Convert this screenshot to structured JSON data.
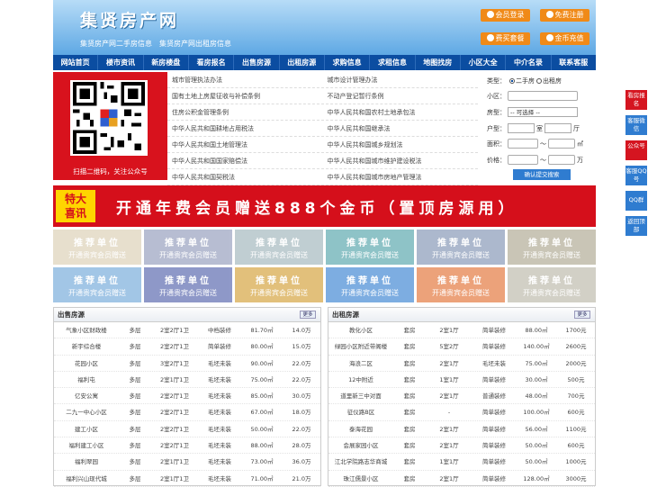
{
  "site": {
    "logo": "集贤房产网",
    "slogan1": "集贤房产网二手房信息",
    "slogan2": "集贤房产网出租房信息"
  },
  "header_buttons": [
    {
      "label": "会员登录"
    },
    {
      "label": "免费注册"
    },
    {
      "label": "费买套餐"
    },
    {
      "label": "金币充值"
    }
  ],
  "nav": [
    "网站首页",
    "楼市资讯",
    "新房楼盘",
    "看房报名",
    "出售房源",
    "出租房源",
    "求购信息",
    "求租信息",
    "地图找房",
    "小区大全",
    "中介名录",
    "联系客服"
  ],
  "qr_caption": "扫描二维码，关注公众号",
  "law_links": [
    [
      "城市管理执法办法",
      "城市设计管理办法"
    ],
    [
      "国有土地上房屋征收与补偿条例",
      "不动产登记暂行条例"
    ],
    [
      "住房公积金管理条例",
      "中华人民共和国农村土地承包法"
    ],
    [
      "中华人民共和国耕地占用税法",
      "中华人民共和国继承法"
    ],
    [
      "中华人民共和国土地管理法",
      "中华人民共和国城乡规划法"
    ],
    [
      "中华人民共和国国家赔偿法",
      "中华人民共和国城市维护建设税法"
    ],
    [
      "中华人民共和国契税法",
      "中华人民共和国城市房地产管理法"
    ]
  ],
  "search": {
    "type_label": "类型：",
    "opt_sale": "二手房",
    "opt_rent": "出租房",
    "area_label": "小区：",
    "house_label": "房型：",
    "house_value": "-- 可选择 --",
    "layout_label": "户型：",
    "room": "室",
    "hall": "厅",
    "size_label": "面积：",
    "size_unit": "㎡",
    "price_label": "价格：",
    "price_unit": "万",
    "dash": "～",
    "submit": "确认提交搜索"
  },
  "banner": {
    "badge1": "特大",
    "badge2": "喜讯",
    "text": "开通年费会员赠送888个金币（置顶房源用）"
  },
  "ads": {
    "title": "推荐单位",
    "sub": "开通贵宾会员赠送"
  },
  "ad_colors": [
    "#d9ccb0",
    "#8c96b8",
    "#9bb1b8",
    "#4aa0a6",
    "#7a8db0",
    "#a9a38a",
    "#6aa4d8",
    "#4a5aa8",
    "#d19a2c",
    "#2f7cd0",
    "#e26a2a",
    "#b8b4a4"
  ],
  "sale": {
    "title": "出售房源",
    "more": "更多",
    "rows": [
      [
        "气象小区财政楼",
        "多层",
        "2室2厅1卫",
        "中档装修",
        "81.70㎡",
        "14.0万"
      ],
      [
        "新宇综合楼",
        "多层",
        "2室2厅1卫",
        "简单装修",
        "80.00㎡",
        "15.0万"
      ],
      [
        "花园小区",
        "多层",
        "3室2厅1卫",
        "毛坯未装",
        "90.00㎡",
        "22.0万"
      ],
      [
        "福利屯",
        "多层",
        "2室1厅1卫",
        "毛坯未装",
        "75.00㎡",
        "22.0万"
      ],
      [
        "亿安公寓",
        "多层",
        "2室2厅1卫",
        "毛坯未装",
        "85.00㎡",
        "30.0万"
      ],
      [
        "二九一中心小区",
        "多层",
        "2室2厅1卫",
        "毛坯未装",
        "67.00㎡",
        "18.0万"
      ],
      [
        "建工小区",
        "多层",
        "2室2厅1卫",
        "毛坯未装",
        "50.00㎡",
        "22.0万"
      ],
      [
        "福利建工小区",
        "多层",
        "2室2厅1卫",
        "毛坯未装",
        "88.00㎡",
        "28.0万"
      ],
      [
        "福利翠园",
        "多层",
        "2室1厅1卫",
        "毛坯未装",
        "73.00㎡",
        "36.0万"
      ],
      [
        "福利兴山现代城",
        "多层",
        "2室1厅1卫",
        "毛坯未装",
        "71.00㎡",
        "21.0万"
      ]
    ]
  },
  "rent": {
    "title": "出租房源",
    "more": "更多",
    "rows": [
      [
        "教化小区",
        "套房",
        "2室1厅",
        "简单装修",
        "88.00㎡",
        "1700元"
      ],
      [
        "绿园小区附近带阁楼",
        "套房",
        "5室2厅",
        "简单装修",
        "140.00㎡",
        "2600元"
      ],
      [
        "海浪二区",
        "套房",
        "2室1厅",
        "毛坯未装",
        "75.00㎡",
        "2000元"
      ],
      [
        "12中附近",
        "套房",
        "1室1厅",
        "简单装修",
        "30.00㎡",
        "500元"
      ],
      [
        "道里新三中对面",
        "套房",
        "2室1厅",
        "普通装修",
        "48.00㎡",
        "700元"
      ],
      [
        "征仪路B区",
        "套房",
        "-",
        "简单装修",
        "100.00㎡",
        "600元"
      ],
      [
        "泰海花园",
        "套房",
        "2室1厅",
        "简单装修",
        "56.00㎡",
        "1100元"
      ],
      [
        "会展家园小区",
        "套房",
        "2室1厅",
        "简单装修",
        "50.00㎡",
        "600元"
      ],
      [
        "江北学院路志华商城",
        "套房",
        "1室1厅",
        "简单装修",
        "50.00㎡",
        "1000元"
      ],
      [
        "珠江儒景小区",
        "套房",
        "2室1厅",
        "简单装修",
        "128.00㎡",
        "3000元"
      ]
    ]
  },
  "sidebar": [
    "看房报名",
    "客服微信",
    "公众号",
    "客服QQ号",
    "QQ群",
    "返回顶部"
  ]
}
